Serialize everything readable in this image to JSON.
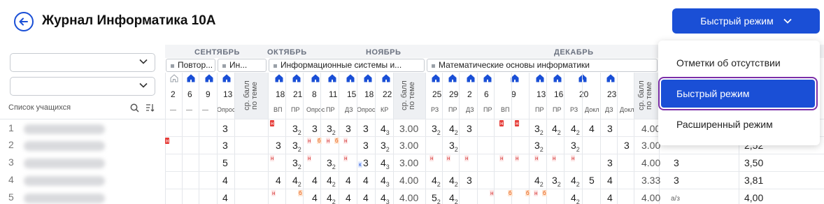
{
  "header": {
    "title": "Журнал Информатика 10А",
    "mode_button": "Быстрый режим"
  },
  "left_panel": {
    "list_label": "Список учащихся",
    "rows": [
      "1",
      "2",
      "3",
      "4",
      "5"
    ]
  },
  "months": [
    "СЕНТЯБРЬ",
    "ОКТЯБРЬ",
    "НОЯБРЬ",
    "ДЕКАБРЬ"
  ],
  "topics": [
    "Повтор...",
    "Ин...",
    "Информационные системы и...",
    "Математические основы информатики"
  ],
  "days": [
    "2",
    "6",
    "9",
    "13",
    "18",
    "21",
    "8",
    "11",
    "15",
    "18",
    "22",
    "25",
    "29",
    "2",
    "6",
    "9",
    "13",
    "16",
    "20",
    "23"
  ],
  "types": [
    "—",
    "—",
    "—",
    "Опрос",
    "ВП",
    "ПР",
    "Опрос",
    "ПР",
    "ДЗ",
    "Опрос",
    "КР",
    "РЗ",
    "ПР",
    "ДЗ",
    "ПР",
    "ВП",
    "ПР",
    "ПР",
    "РЗ",
    "Докл",
    "ДЗ",
    "Докл"
  ],
  "avg_label": "ср. балл по теме",
  "avg_values": {
    "topic2": [
      "",
      "",
      "",
      "",
      ""
    ],
    "topic3": [
      "3.00",
      "3.00",
      "3.00",
      "4.00",
      "4.00"
    ],
    "topic4": [
      "4.00",
      "3.00",
      "4.00",
      "3.33",
      "4.00"
    ]
  },
  "last_col": [
    "",
    "2,52",
    "3,50",
    "3,81",
    "4,00"
  ],
  "extra_col": [
    "",
    "",
    "3",
    "3",
    "а/з"
  ],
  "menu": {
    "items": [
      "Отметки об отсутствии",
      "Быстрый режим",
      "Расширенный режим"
    ]
  }
}
